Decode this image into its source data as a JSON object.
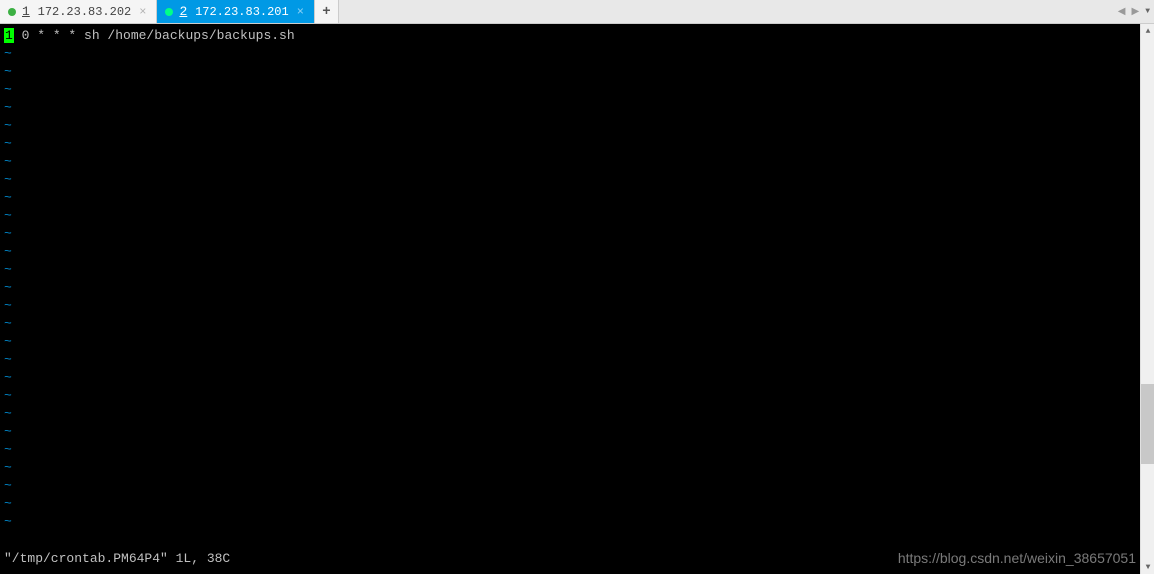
{
  "tabs": [
    {
      "number": "1",
      "label": "172.23.83.202",
      "dot": "green",
      "active": false
    },
    {
      "number": "2",
      "label": "172.23.83.201",
      "dot": "green-bright",
      "active": true
    }
  ],
  "newTabLabel": "+",
  "terminal": {
    "cursor_char": "1",
    "line_rest": " 0 * * * sh /home/backups/backups.sh",
    "tilde": "~",
    "tilde_count": 27,
    "status": "\"/tmp/crontab.PM64P4\" 1L, 38C"
  },
  "scrollbar": {
    "up": "▲",
    "down": "▼"
  },
  "navArrows": {
    "left": "◀",
    "right": "▶",
    "down": "▼"
  },
  "watermark": "https://blog.csdn.net/weixin_38657051"
}
